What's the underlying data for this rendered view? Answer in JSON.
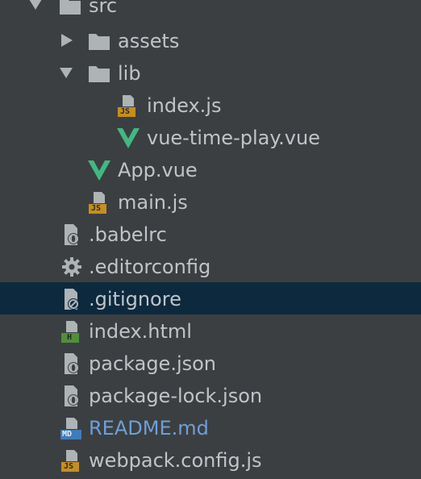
{
  "tree": {
    "items": [
      {
        "label": "src",
        "icon": "folder-icon"
      },
      {
        "label": "assets",
        "icon": "folder-icon"
      },
      {
        "label": "lib",
        "icon": "folder-icon"
      },
      {
        "label": "index.js",
        "icon": "js-file-icon"
      },
      {
        "label": "vue-time-play.vue",
        "icon": "vue-file-icon"
      },
      {
        "label": "App.vue",
        "icon": "vue-file-icon"
      },
      {
        "label": "main.js",
        "icon": "js-file-icon"
      },
      {
        "label": ".babelrc",
        "icon": "config-file-icon"
      },
      {
        "label": ".editorconfig",
        "icon": "gear-icon"
      },
      {
        "label": ".gitignore",
        "icon": "ignore-file-icon"
      },
      {
        "label": "index.html",
        "icon": "html-file-icon"
      },
      {
        "label": "package.json",
        "icon": "config-file-icon"
      },
      {
        "label": "package-lock.json",
        "icon": "config-file-icon"
      },
      {
        "label": "README.md",
        "icon": "md-file-icon"
      },
      {
        "label": "webpack.config.js",
        "icon": "js-file-icon"
      }
    ],
    "js_badge": "JS",
    "html_badge": "H",
    "md_badge": "MD"
  },
  "colors": {
    "background": "#3c3f41",
    "selected_row": "#0d293e",
    "text": "#c0c4c8",
    "readme_text": "#6f9fd6",
    "folder": "#aeb3b6",
    "vue_green": "#41b883",
    "js_badge": "#c48f1e",
    "html_badge": "#4f8f3a",
    "md_badge": "#3f7cba"
  }
}
